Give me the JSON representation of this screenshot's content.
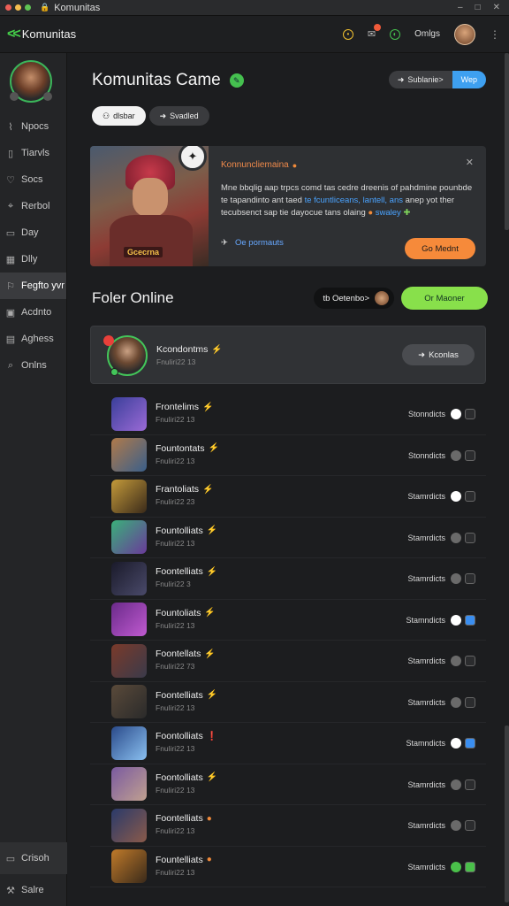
{
  "window": {
    "title": "Komunitas",
    "controls": [
      "–",
      "□",
      "✕"
    ]
  },
  "appbar": {
    "brand": "Komunitas",
    "user_label": "Omlgs"
  },
  "sidebar": {
    "items": [
      {
        "label": "Npocs",
        "icon": "chart-icon"
      },
      {
        "label": "Tiarvls",
        "icon": "book-icon"
      },
      {
        "label": "Socs",
        "icon": "heart-icon"
      },
      {
        "label": "Rerbol",
        "icon": "pin-icon"
      },
      {
        "label": "Day",
        "icon": "calendar-icon"
      },
      {
        "label": "Dlly",
        "icon": "grid-icon"
      },
      {
        "label": "Fegfto yvr",
        "icon": "flag-icon",
        "active": true
      },
      {
        "label": "Acdnto",
        "icon": "image-icon"
      },
      {
        "label": "Aghess",
        "icon": "map-icon"
      },
      {
        "label": "Onlns",
        "icon": "search-icon"
      }
    ],
    "bottom": [
      {
        "label": "Crisoh",
        "icon": "monitor-icon"
      },
      {
        "label": "Salre",
        "icon": "tools-icon"
      }
    ]
  },
  "header": {
    "title": "Komunitas Came",
    "subscribe_label": "Sublanie>",
    "web_label": "Wep",
    "pill_1": "dlsbar",
    "pill_2": "Svadled"
  },
  "feature": {
    "art_label": "Gcecrna",
    "heading": "Konnuncliemaina",
    "text_1": "Mne bbqlig aap trpcs comd tas cedre dreenis of pahdmine pounbde te tapandinto ant taed",
    "text_highlight": "te fcuntliceans, lantell, ans",
    "text_2": "anep yot ther tecubsenct sap tie dayocue tans olaing",
    "text_green": "swaley",
    "footer_link": "Oe pormauts",
    "cta_label": "Go Mednt"
  },
  "section": {
    "title": "Foler Online",
    "chip_label": "tb Oetenbo>",
    "green_btn": "Or Maoner"
  },
  "highlight": {
    "name": "Kcondontms",
    "sub": "Fnuliri22 13",
    "btn_label": "Kconlas"
  },
  "rows": [
    {
      "name": "Frontelims",
      "sub": "Fnuliri22 13",
      "status": "Stonndicts",
      "bolt": "⚡",
      "bolt_color": "#f05a3a",
      "toggle": "#ffffff",
      "sq": "#2b2c2e",
      "thumb": [
        "#3a3f9a",
        "#9b6ad6"
      ]
    },
    {
      "name": "Fountontats",
      "sub": "Fnuliri22 13",
      "status": "Stonndicts",
      "bolt": "⚡",
      "bolt_color": "#f05a3a",
      "toggle": "#6a6a6a",
      "sq": "#2b2c2e",
      "thumb": [
        "#b07a4a",
        "#3a5f8a"
      ]
    },
    {
      "name": "Frantoliats",
      "sub": "Fnuliri22 23",
      "status": "Stamrdicts",
      "bolt": "⚡",
      "bolt_color": "#4a8ef0",
      "toggle": "#ffffff",
      "sq": "#2b2c2e",
      "thumb": [
        "#c49a3a",
        "#3a2a1a"
      ]
    },
    {
      "name": "Fountolliats",
      "sub": "Fnuliri22 13",
      "status": "Stamrdicts",
      "bolt": "⚡",
      "bolt_color": "#9a5ae0",
      "toggle": "#6a6a6a",
      "sq": "#2b2c2e",
      "thumb": [
        "#3ab07a",
        "#6a3a9a"
      ]
    },
    {
      "name": "Foontelliats",
      "sub": "Fnuliri22 3",
      "status": "Stamrdicts",
      "bolt": "⚡",
      "bolt_color": "#9a5ae0",
      "toggle": "#6a6a6a",
      "sq": "#2b2c2e",
      "thumb": [
        "#1a1a2a",
        "#4a4a6a"
      ]
    },
    {
      "name": "Fountoliats",
      "sub": "Fnuliri22 13",
      "status": "Stamndicts",
      "bolt": "⚡",
      "bolt_color": "#f0c030",
      "toggle": "#ffffff",
      "sq": "#3a8ef0",
      "thumb": [
        "#6a2a8a",
        "#c05ad0"
      ]
    },
    {
      "name": "Foontellats",
      "sub": "Fnuliri22 73",
      "status": "Stamrdicts",
      "bolt": "⚡",
      "bolt_color": "#4ac04a",
      "toggle": "#6a6a6a",
      "sq": "#2b2c2e",
      "thumb": [
        "#7a3a2a",
        "#3a3a4a"
      ]
    },
    {
      "name": "Foontelliats",
      "sub": "Fnuliri22 13",
      "status": "Stamrdicts",
      "bolt": "⚡",
      "bolt_color": "#4ac04a",
      "toggle": "#6a6a6a",
      "sq": "#2b2c2e",
      "thumb": [
        "#5a4a3a",
        "#2a2a2a"
      ]
    },
    {
      "name": "Foontolliats",
      "sub": "Fnuliri22 13",
      "status": "Stamndicts",
      "bolt": "❗",
      "bolt_color": "#e84040",
      "toggle": "#ffffff",
      "sq": "#3a8ef0",
      "thumb": [
        "#2a4a8a",
        "#8ac0f0"
      ]
    },
    {
      "name": "Foontolliats",
      "sub": "Fnuliri22 13",
      "status": "Stamrdicts",
      "bolt": "⚡",
      "bolt_color": "#4a8ef0",
      "toggle": "#6a6a6a",
      "sq": "#2b2c2e",
      "thumb": [
        "#7a5aa0",
        "#c0a090"
      ]
    },
    {
      "name": "Foontelliats",
      "sub": "Fnuliri22 13",
      "status": "Stamrdicts",
      "bolt": "●",
      "bolt_color": "#f08a3a",
      "toggle": "#6a6a6a",
      "sq": "#2b2c2e",
      "thumb": [
        "#2a3a6a",
        "#8a5a4a"
      ]
    },
    {
      "name": "Fountelliats",
      "sub": "Fnuliri22 13",
      "status": "Stamrdicts",
      "bolt": "●",
      "bolt_color": "#f08a3a",
      "toggle": "#4ac04a",
      "sq": "#4ac04a",
      "thumb": [
        "#c07a2a",
        "#3a2a1a"
      ]
    }
  ],
  "colors": {
    "accent_green": "#45d14a",
    "accent_orange": "#f68a3a",
    "accent_blue": "#3ea0f0"
  }
}
